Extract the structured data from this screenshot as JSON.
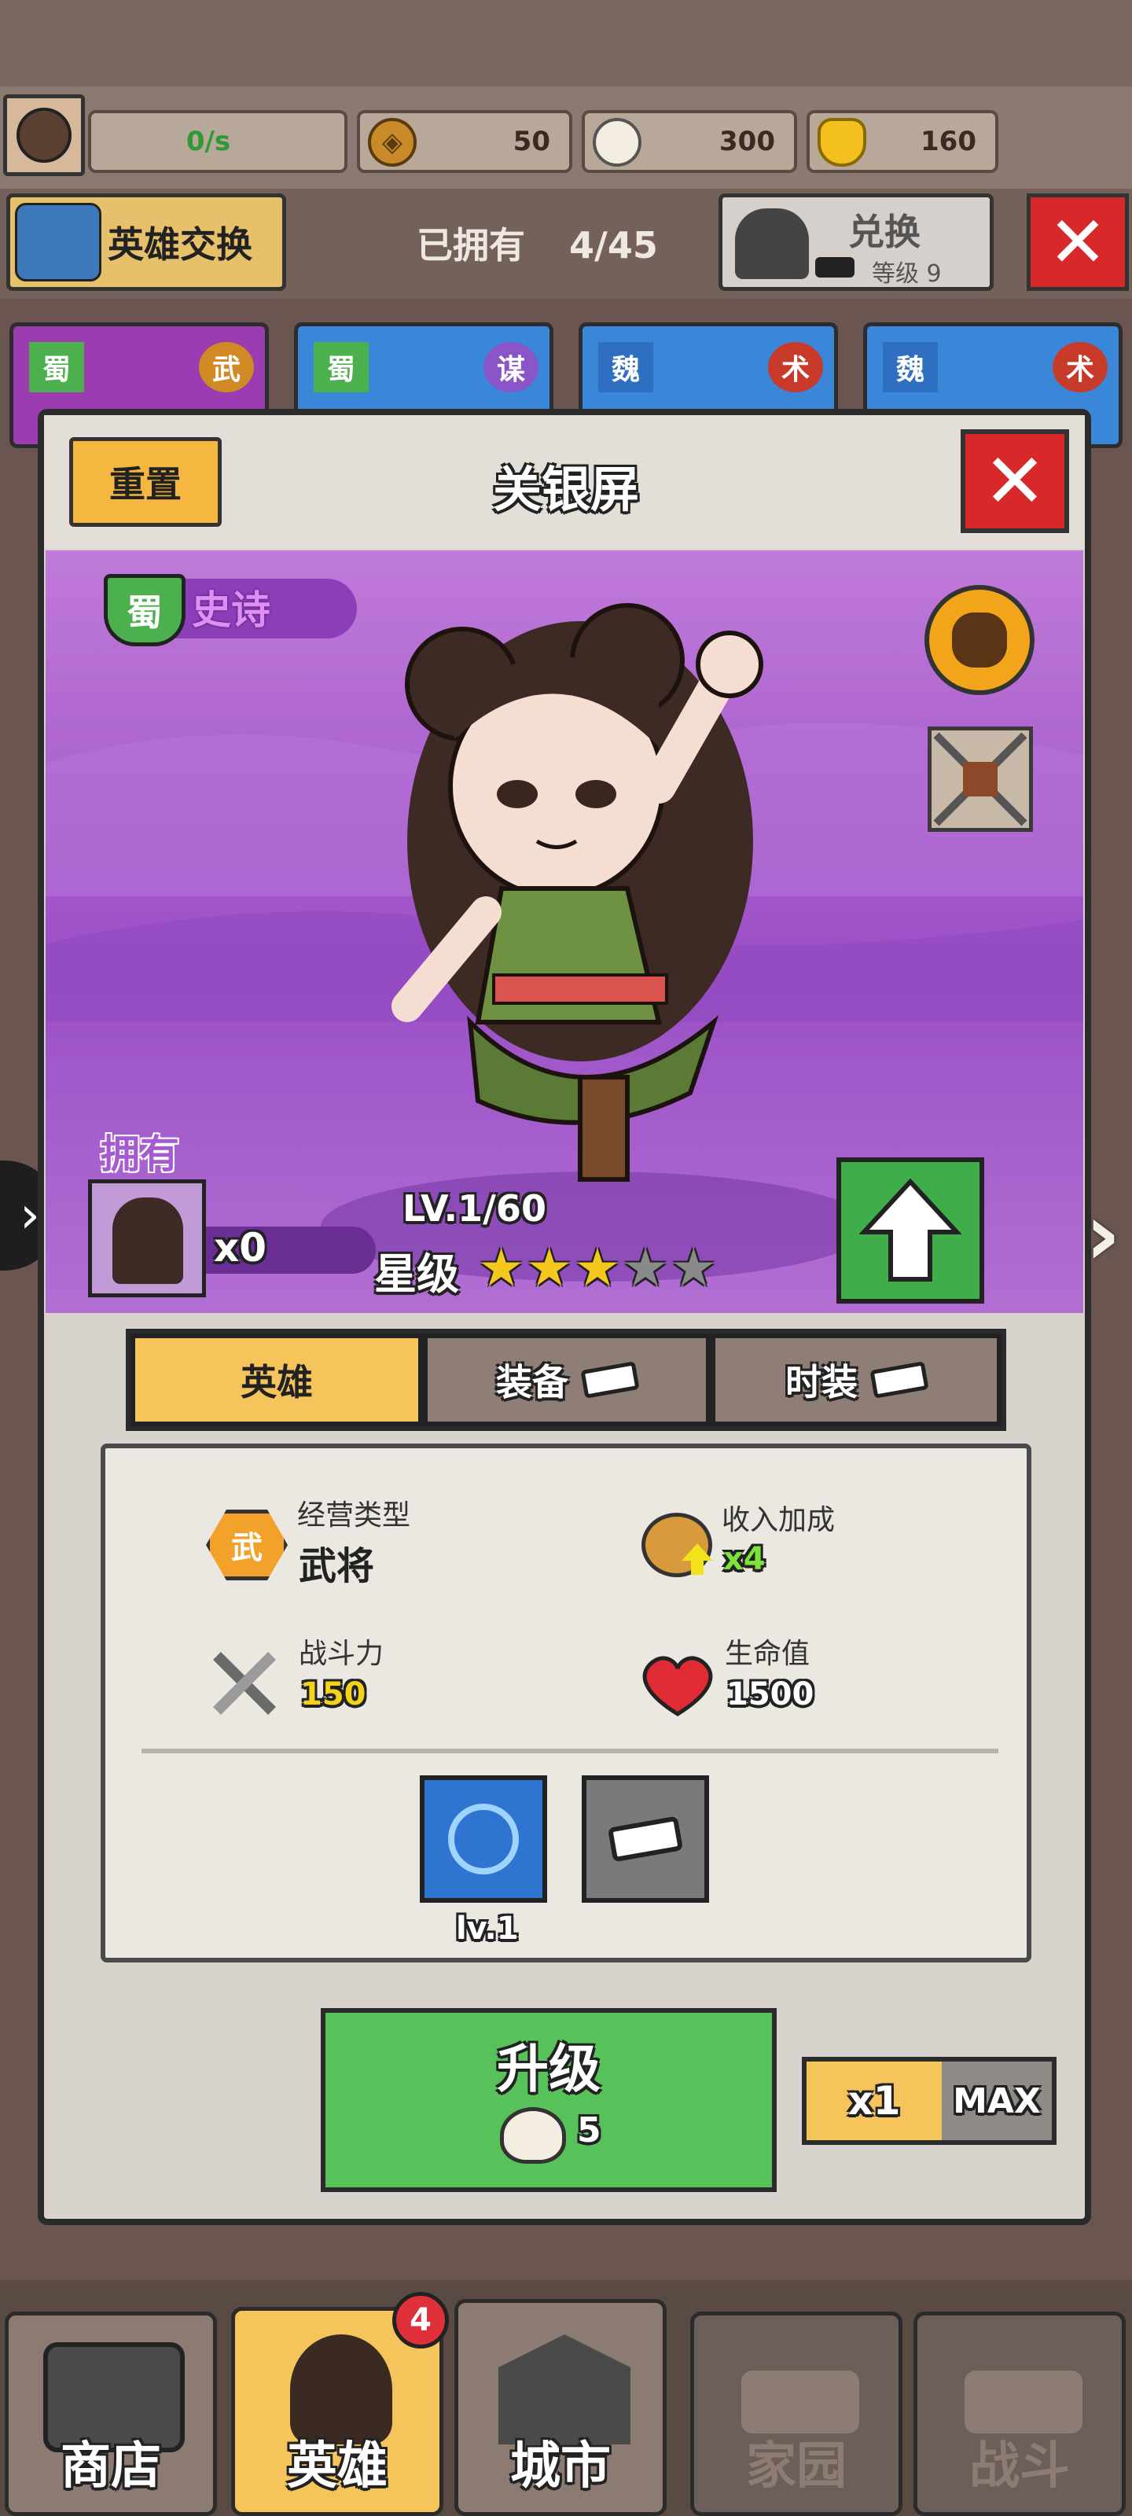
{
  "top": {
    "income_rate": "0/s",
    "coins": "50",
    "buns": "300",
    "gold": "160"
  },
  "header": {
    "swap_label": "英雄交换",
    "owned_label": "已拥有",
    "owned_count": "4/45",
    "exchange_label": "兑换",
    "exchange_level": "等级 9"
  },
  "bg_cards": [
    {
      "faction": "蜀",
      "type": "武"
    },
    {
      "faction": "蜀",
      "type": "谋"
    },
    {
      "faction": "魏",
      "type": "术"
    },
    {
      "faction": "魏",
      "type": "术"
    }
  ],
  "modal": {
    "reset_label": "重置",
    "hero_name": "关银屏",
    "faction": "蜀",
    "rarity": "史诗",
    "owned_label": "拥有",
    "owned_count": "x0",
    "level": "LV.1/60",
    "star_label": "星级",
    "stars_filled": 3,
    "stars_total": 5,
    "tabs": [
      {
        "label": "英雄",
        "active": true
      },
      {
        "label": "装备",
        "active": false
      },
      {
        "label": "时装",
        "active": false
      }
    ],
    "stats": {
      "type_badge": "武",
      "business_type_label": "经营类型",
      "business_type_value": "武将",
      "income_bonus_label": "收入加成",
      "income_bonus_value": "x4",
      "combat_label": "战斗力",
      "combat_value": "150",
      "hp_label": "生命值",
      "hp_value": "1500"
    },
    "skill_level": "lv.1",
    "upgrade_label": "升级",
    "upgrade_cost": "5",
    "x1_label": "x1",
    "max_label": "MAX"
  },
  "nav": {
    "shop": "商店",
    "hero": "英雄",
    "hero_badge": "4",
    "city": "城市",
    "home": "家园",
    "battle": "战斗"
  },
  "colors": {
    "accent_yellow": "#f4c55c",
    "green_button": "#57c15a",
    "red_close": "#d51f23",
    "purple_stage": "#a55bcf",
    "shu_green": "#4bb04d",
    "wei_blue": "#3a86d8",
    "stat_yellow": "#f2d21a",
    "stat_green": "#7ee23c"
  }
}
